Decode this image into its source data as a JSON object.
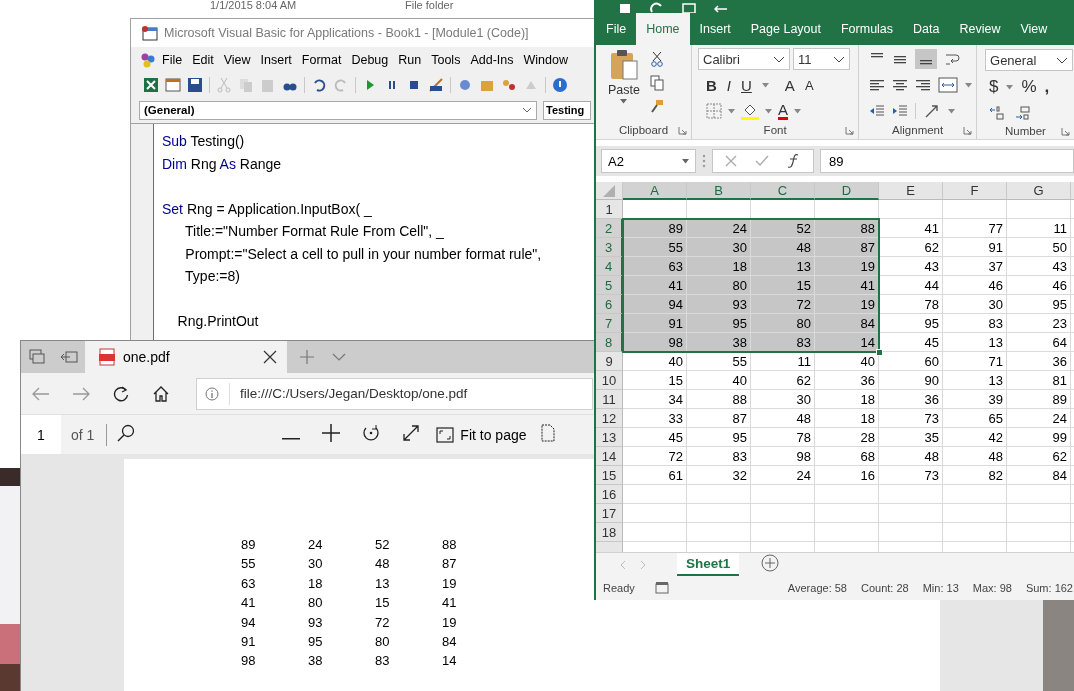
{
  "explorer_background": {
    "rows": [
      {
        "date": "1/1/2015 8:04 AM",
        "type": "File folder"
      }
    ]
  },
  "vba_window": {
    "title": "Microsoft Visual Basic for Applications - Book1 - [Module1 (Code)]",
    "menu": [
      "File",
      "Edit",
      "View",
      "Insert",
      "Format",
      "Debug",
      "Run",
      "Tools",
      "Add-Ins",
      "Window"
    ],
    "object_box": "(General)",
    "procedure_box": "Testing",
    "code_lines": [
      {
        "gap_before": false,
        "segments": [
          {
            "text": "Sub",
            "kind": "keyword"
          },
          {
            "text": " Testing()",
            "kind": "plain"
          }
        ]
      },
      {
        "gap_before": false,
        "segments": [
          {
            "text": "Dim",
            "kind": "keyword"
          },
          {
            "text": " Rng ",
            "kind": "plain"
          },
          {
            "text": "As",
            "kind": "keyword"
          },
          {
            "text": " Range",
            "kind": "plain"
          }
        ]
      },
      {
        "gap_before": true,
        "segments": [
          {
            "text": "Set",
            "kind": "keyword"
          },
          {
            "text": " Rng = Application.InputBox( _",
            "kind": "plain"
          }
        ]
      },
      {
        "gap_before": false,
        "segments": [
          {
            "text": "      Title:=\"Number Format Rule From Cell\", _",
            "kind": "plain"
          }
        ]
      },
      {
        "gap_before": false,
        "segments": [
          {
            "text": "      Prompt:=\"Select a cell to pull in your number format rule\",",
            "kind": "plain"
          }
        ]
      },
      {
        "gap_before": false,
        "segments": [
          {
            "text": "      Type:=8)",
            "kind": "plain"
          }
        ]
      },
      {
        "gap_before": true,
        "segments": [
          {
            "text": "    Rng.PrintOut",
            "kind": "plain"
          }
        ]
      }
    ]
  },
  "pdf_viewer": {
    "tab_title": "one.pdf",
    "address": "file:///C:/Users/Jegan/Desktop/one.pdf",
    "page_number": "1",
    "page_count": "of 1",
    "fit_button": "Fit to page",
    "pdf_table": [
      [
        "89",
        "24",
        "52",
        "88"
      ],
      [
        "55",
        "30",
        "48",
        "87"
      ],
      [
        "63",
        "18",
        "13",
        "19"
      ],
      [
        "41",
        "80",
        "15",
        "41"
      ],
      [
        "94",
        "93",
        "72",
        "19"
      ],
      [
        "91",
        "95",
        "80",
        "84"
      ],
      [
        "98",
        "38",
        "83",
        "14"
      ]
    ]
  },
  "excel": {
    "ribbon_tabs": [
      {
        "label": "File",
        "selected": false
      },
      {
        "label": "Home",
        "selected": true
      },
      {
        "label": "Insert",
        "selected": false
      },
      {
        "label": "Page Layout",
        "selected": false
      },
      {
        "label": "Formulas",
        "selected": false
      },
      {
        "label": "Data",
        "selected": false
      },
      {
        "label": "Review",
        "selected": false
      },
      {
        "label": "View",
        "selected": false
      }
    ],
    "paste_label": "Paste",
    "font_name": "Calibri",
    "font_size": "11",
    "style_buttons": [
      "B",
      "I",
      "U"
    ],
    "grow_font": "A",
    "shrink_font": "A",
    "font_color": "A",
    "number_format": "General",
    "number_buttons": [
      "$",
      "%",
      ","
    ],
    "group_labels": [
      "Clipboard",
      "Font",
      "Alignment",
      "Number"
    ],
    "name_box": "A2",
    "formula": "89",
    "columns": [
      {
        "label": "A",
        "selected": true
      },
      {
        "label": "B",
        "selected": true
      },
      {
        "label": "C",
        "selected": true
      },
      {
        "label": "D",
        "selected": true
      },
      {
        "label": "E",
        "selected": false
      },
      {
        "label": "F",
        "selected": false
      },
      {
        "label": "G",
        "selected": false
      }
    ],
    "rows": [
      {
        "header": "1",
        "selected": false
      },
      {
        "header": "2",
        "selected": true,
        "cells": [
          {
            "text": "89",
            "selected": true
          },
          {
            "text": "24",
            "selected": true
          },
          {
            "text": "52",
            "selected": true
          },
          {
            "text": "88",
            "selected": true
          },
          {
            "text": "41",
            "selected": false
          },
          {
            "text": "77",
            "selected": false
          },
          {
            "text": "11",
            "selected": false
          }
        ]
      },
      {
        "header": "3",
        "selected": true,
        "cells": [
          {
            "text": "55",
            "selected": true
          },
          {
            "text": "30",
            "selected": true
          },
          {
            "text": "48",
            "selected": true
          },
          {
            "text": "87",
            "selected": true
          },
          {
            "text": "62",
            "selected": false
          },
          {
            "text": "91",
            "selected": false
          },
          {
            "text": "50",
            "selected": false
          }
        ]
      },
      {
        "header": "4",
        "selected": true,
        "cells": [
          {
            "text": "63",
            "selected": true
          },
          {
            "text": "18",
            "selected": true
          },
          {
            "text": "13",
            "selected": true
          },
          {
            "text": "19",
            "selected": true
          },
          {
            "text": "43",
            "selected": false
          },
          {
            "text": "37",
            "selected": false
          },
          {
            "text": "43",
            "selected": false
          }
        ]
      },
      {
        "header": "5",
        "selected": true,
        "cells": [
          {
            "text": "41",
            "selected": true
          },
          {
            "text": "80",
            "selected": true
          },
          {
            "text": "15",
            "selected": true
          },
          {
            "text": "41",
            "selected": true
          },
          {
            "text": "44",
            "selected": false
          },
          {
            "text": "46",
            "selected": false
          },
          {
            "text": "46",
            "selected": false
          }
        ]
      },
      {
        "header": "6",
        "selected": true,
        "cells": [
          {
            "text": "94",
            "selected": true
          },
          {
            "text": "93",
            "selected": true
          },
          {
            "text": "72",
            "selected": true
          },
          {
            "text": "19",
            "selected": true
          },
          {
            "text": "78",
            "selected": false
          },
          {
            "text": "30",
            "selected": false
          },
          {
            "text": "95",
            "selected": false
          }
        ]
      },
      {
        "header": "7",
        "selected": true,
        "cells": [
          {
            "text": "91",
            "selected": true
          },
          {
            "text": "95",
            "selected": true
          },
          {
            "text": "80",
            "selected": true
          },
          {
            "text": "84",
            "selected": true
          },
          {
            "text": "95",
            "selected": false
          },
          {
            "text": "83",
            "selected": false
          },
          {
            "text": "23",
            "selected": false
          }
        ]
      },
      {
        "header": "8",
        "selected": true,
        "cells": [
          {
            "text": "98",
            "selected": true
          },
          {
            "text": "38",
            "selected": true
          },
          {
            "text": "83",
            "selected": true
          },
          {
            "text": "14",
            "selected": true
          },
          {
            "text": "45",
            "selected": false
          },
          {
            "text": "13",
            "selected": false
          },
          {
            "text": "64",
            "selected": false
          }
        ]
      },
      {
        "header": "9",
        "selected": false,
        "cells": [
          {
            "text": "40",
            "selected": false
          },
          {
            "text": "55",
            "selected": false
          },
          {
            "text": "11",
            "selected": false
          },
          {
            "text": "40",
            "selected": false
          },
          {
            "text": "60",
            "selected": false
          },
          {
            "text": "71",
            "selected": false
          },
          {
            "text": "36",
            "selected": false
          }
        ]
      },
      {
        "header": "10",
        "selected": false,
        "cells": [
          {
            "text": "15",
            "selected": false
          },
          {
            "text": "40",
            "selected": false
          },
          {
            "text": "62",
            "selected": false
          },
          {
            "text": "36",
            "selected": false
          },
          {
            "text": "90",
            "selected": false
          },
          {
            "text": "13",
            "selected": false
          },
          {
            "text": "81",
            "selected": false
          }
        ]
      },
      {
        "header": "11",
        "selected": false,
        "cells": [
          {
            "text": "34",
            "selected": false
          },
          {
            "text": "88",
            "selected": false
          },
          {
            "text": "30",
            "selected": false
          },
          {
            "text": "18",
            "selected": false
          },
          {
            "text": "36",
            "selected": false
          },
          {
            "text": "39",
            "selected": false
          },
          {
            "text": "89",
            "selected": false
          }
        ]
      },
      {
        "header": "12",
        "selected": false,
        "cells": [
          {
            "text": "33",
            "selected": false
          },
          {
            "text": "87",
            "selected": false
          },
          {
            "text": "48",
            "selected": false
          },
          {
            "text": "18",
            "selected": false
          },
          {
            "text": "73",
            "selected": false
          },
          {
            "text": "65",
            "selected": false
          },
          {
            "text": "24",
            "selected": false
          }
        ]
      },
      {
        "header": "13",
        "selected": false,
        "cells": [
          {
            "text": "45",
            "selected": false
          },
          {
            "text": "95",
            "selected": false
          },
          {
            "text": "78",
            "selected": false
          },
          {
            "text": "28",
            "selected": false
          },
          {
            "text": "35",
            "selected": false
          },
          {
            "text": "42",
            "selected": false
          },
          {
            "text": "99",
            "selected": false
          }
        ]
      },
      {
        "header": "14",
        "selected": false,
        "cells": [
          {
            "text": "72",
            "selected": false
          },
          {
            "text": "83",
            "selected": false
          },
          {
            "text": "98",
            "selected": false
          },
          {
            "text": "68",
            "selected": false
          },
          {
            "text": "48",
            "selected": false
          },
          {
            "text": "48",
            "selected": false
          },
          {
            "text": "62",
            "selected": false
          }
        ]
      },
      {
        "header": "15",
        "selected": false,
        "cells": [
          {
            "text": "61",
            "selected": false
          },
          {
            "text": "32",
            "selected": false
          },
          {
            "text": "24",
            "selected": false
          },
          {
            "text": "16",
            "selected": false
          },
          {
            "text": "73",
            "selected": false
          },
          {
            "text": "82",
            "selected": false
          },
          {
            "text": "84",
            "selected": false
          }
        ]
      },
      {
        "header": "16",
        "selected": false
      },
      {
        "header": "17",
        "selected": false
      },
      {
        "header": "18",
        "selected": false
      }
    ],
    "sheet_tabs": [
      {
        "label": "Sheet1",
        "selected": true
      }
    ],
    "status_text": "Ready",
    "status_stats": [
      "Average: 58",
      "Count: 28",
      "Min: 13",
      "Max: 98",
      "Sum: 162"
    ]
  }
}
